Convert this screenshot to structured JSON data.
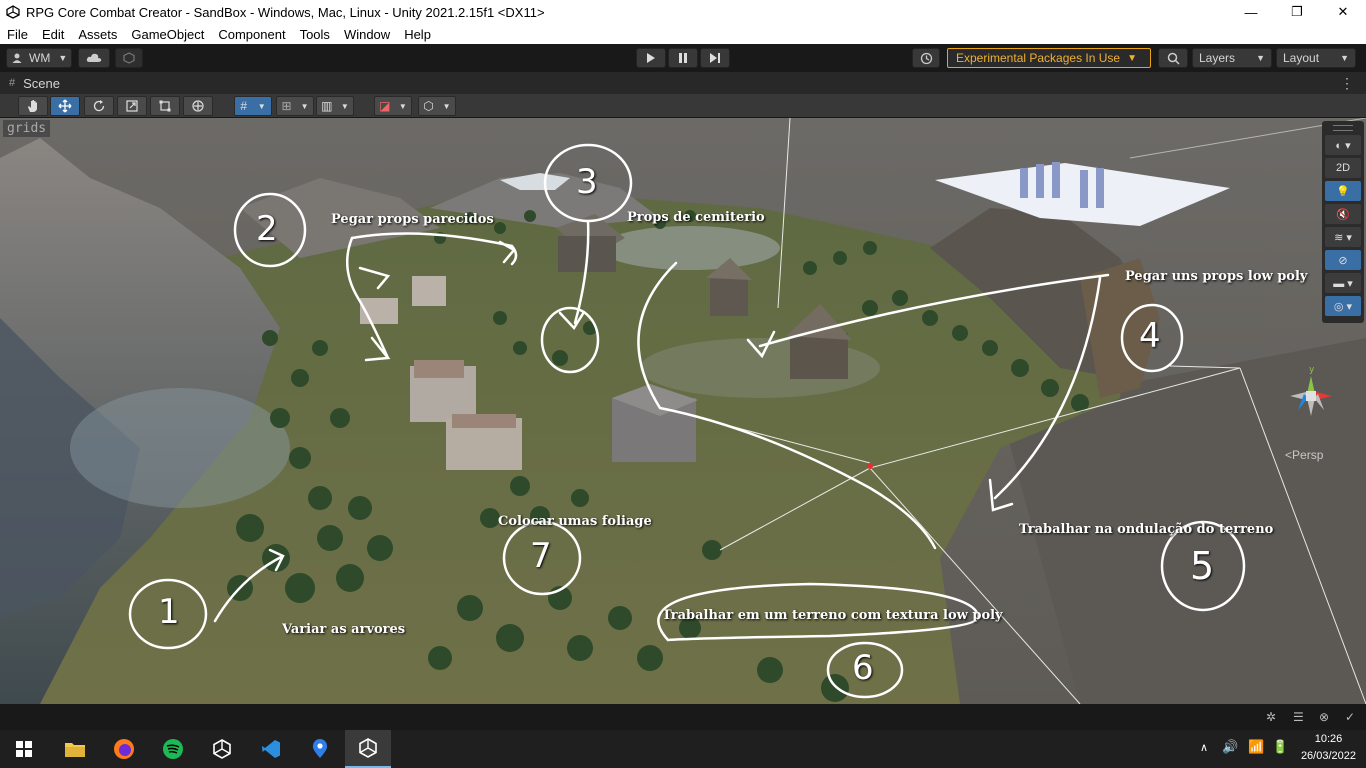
{
  "window": {
    "title": "RPG Core Combat Creator - SandBox - Windows, Mac, Linux - Unity 2021.2.15f1 <DX11>",
    "minimize_glyph": "—",
    "maximize_glyph": "❐",
    "close_glyph": "✕"
  },
  "menu": [
    "File",
    "Edit",
    "Assets",
    "GameObject",
    "Component",
    "Tools",
    "Window",
    "Help"
  ],
  "toolbar": {
    "account": "WM",
    "packages_warning": "Experimental Packages In Use",
    "layers": "Layers",
    "layout": "Layout"
  },
  "scene_tab": {
    "label": "Scene"
  },
  "viewport": {
    "grids_label": "grids",
    "overlay_2d": "2D",
    "gizmo_axis_y": "y",
    "persp_label": "Persp"
  },
  "annotations": [
    "Pegar props parecidos",
    "Props de cemiterio",
    "Pegar uns props low poly",
    "Colocar umas foliage",
    "Trabalhar na ondulação do terreno",
    "Trabalhar em um terreno com textura low poly",
    "Variar as arvores"
  ],
  "annotation_numbers": [
    "1",
    "2",
    "3",
    "4",
    "5",
    "6",
    "7"
  ],
  "clock": {
    "time": "10:26",
    "date": "26/03/2022"
  },
  "colors": {
    "accent_blue": "#3a6fa6",
    "warning_orange": "#e8a317",
    "terrain_green": "#5d6a3a"
  }
}
